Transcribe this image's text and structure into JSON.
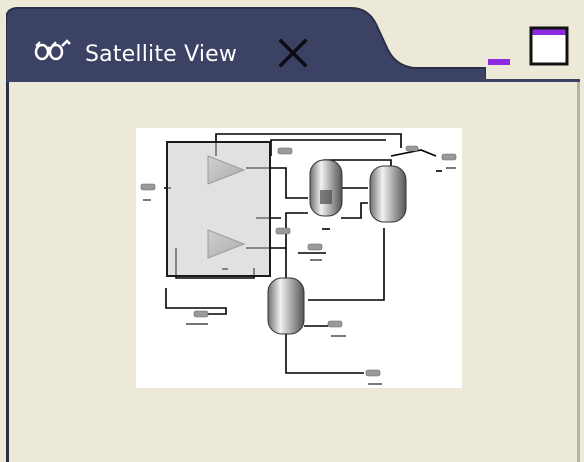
{
  "panel": {
    "title": "Satellite View",
    "icon": "satellite-view-icon",
    "close_icon": "close-icon",
    "minimize_icon": "minimize-icon",
    "maximize_icon": "maximize-icon"
  },
  "colors": {
    "tab_background": "#3c4263",
    "tab_text": "#ffffff",
    "panel_background": "#ece9d8",
    "minimize_accent": "#8a2be2",
    "canvas_background": "#ffffff"
  },
  "diagram": {
    "type": "process-flowsheet-overview",
    "elements": [
      "compressor",
      "compressor",
      "vessel",
      "column",
      "vessel"
    ]
  }
}
